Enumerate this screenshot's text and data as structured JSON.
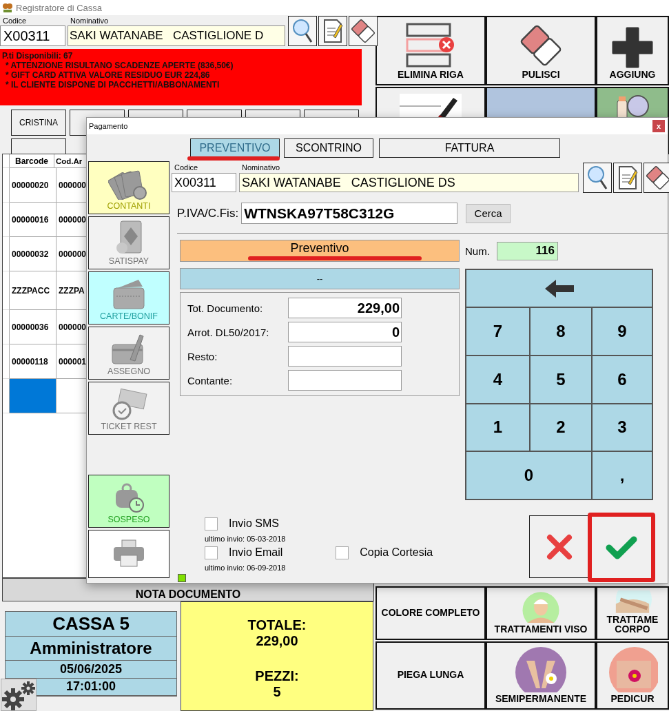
{
  "app": {
    "title": "Registratore di Cassa"
  },
  "customer": {
    "code_label": "Codice",
    "name_label": "Nominativo",
    "code": "X00311",
    "name": "SAKI WATANABE   CASTIGLIONE D"
  },
  "alert": {
    "points": "P.ti Disponibili: 67",
    "lines": [
      "* ATTENZIONE RISULTANO SCADENZE APERTE (836,50€)",
      "* GIFT CARD ATTIVA VALORE RESIDUO EUR 224,86",
      "* IL CLIENTE DISPONE DI PACCHETTI/ABBONAMENTI"
    ]
  },
  "operator_rows": [
    [
      {
        "kind": "named",
        "label": "CRISTINA"
      },
      {
        "kind": "blank"
      },
      {
        "kind": "blank"
      },
      {
        "kind": "blank"
      },
      {
        "kind": "blank"
      },
      {
        "kind": "blank"
      }
    ],
    [
      {
        "kind": "blank"
      }
    ]
  ],
  "table": {
    "columns": [
      "Barcode",
      "Cod.Ar"
    ],
    "rows": [
      {
        "cells": [
          "00000020",
          "000000"
        ],
        "selected": false
      },
      {
        "cells": [
          "00000016",
          "000000"
        ],
        "selected": false
      },
      {
        "cells": [
          "00000032",
          "000000"
        ],
        "selected": false
      },
      {
        "cells": [
          "ZZZPACC",
          "ZZZPA"
        ],
        "selected": false
      },
      {
        "cells": [
          "00000036",
          "000000"
        ],
        "selected": false
      },
      {
        "cells": [
          "00000118",
          "000001"
        ],
        "selected": false
      },
      {
        "selected": true
      }
    ]
  },
  "note_bar": "NOTA DOCUMENTO",
  "register": {
    "name": "CASSA 5",
    "user": "Amministratore",
    "date": "05/06/2025",
    "time": "17:01:00"
  },
  "totals": {
    "total_label": "TOTALE:",
    "total": "229,00",
    "pieces_label": "PEZZI:",
    "pieces": "5"
  },
  "tiles_top": [
    {
      "kind": "delete-row",
      "label": "ELIMINA RIGA",
      "color": "#f0f0f0"
    },
    {
      "kind": "eraser",
      "label": "PULISCI",
      "color": "#f0f0f0"
    },
    {
      "kind": "plus",
      "label": "AGGIUNG",
      "color": "#f0f0f0"
    },
    {
      "kind": "pen",
      "color": "#f0f0f0"
    },
    {
      "kind": "none",
      "color": "#b0c4de"
    },
    {
      "kind": "bottles",
      "color": "#8fbc8b"
    }
  ],
  "tiles_bottom": [
    {
      "kind": "none",
      "label": "COLORE COMPLETO",
      "color": "#f0f0f0"
    },
    {
      "kind": "face",
      "label": "TRATTAMENTI VISO",
      "color": "#f0f0f0"
    },
    {
      "kind": "body",
      "label": "TRATTAME CORPO",
      "color": "#f0f0f0"
    },
    {
      "kind": "none",
      "label": "PIEGA LUNGA",
      "color": "#f0f0f0"
    },
    {
      "kind": "hands",
      "label": "SEMIPERMANENTE",
      "color": "#f0f0f0"
    },
    {
      "kind": "feet",
      "label": "PEDICUR",
      "color": "#f0f0f0"
    }
  ],
  "dialog": {
    "title": "Pagamento",
    "close": "x",
    "tabs": [
      {
        "label": "PREVENTIVO",
        "selected": true
      },
      {
        "label": "SCONTRINO",
        "selected": false
      },
      {
        "label": "FATTURA",
        "selected": false
      }
    ],
    "methods": [
      {
        "kind": "cash",
        "label": "CONTANTI",
        "color": "#ffffc0"
      },
      {
        "kind": "satispay",
        "label": "SATISPAY",
        "color": "#f2f2f2"
      },
      {
        "kind": "card",
        "label": "CARTE/BONIF",
        "color": "#c0ffff"
      },
      {
        "kind": "cheque",
        "label": "ASSEGNO",
        "color": "#f2f2f2"
      },
      {
        "kind": "ticket",
        "label": "TICKET REST",
        "color": "#f2f2f2"
      },
      {
        "kind": "hold",
        "label": "SOSPESO",
        "color": "#c0ffc0"
      },
      {
        "kind": "print",
        "color": "#ffffff"
      }
    ],
    "code_label": "Codice",
    "name_label": "Nominativo",
    "code": "X00311",
    "name": "SAKI WATANABE   CASTIGLIONE DS",
    "tax_label": "P.IVA/C.Fis:",
    "tax_id": "WTNSKA97T58C312G",
    "search_button": "Cerca",
    "doc_type": "Preventivo",
    "number_label": "Num.",
    "number": "116",
    "status": "--",
    "amounts": [
      {
        "label": "Tot. Documento:",
        "value": "229,00"
      },
      {
        "label": "Arrot. DL50/2017:",
        "value": "0"
      },
      {
        "label": "Resto:"
      },
      {
        "label": "Contante:"
      }
    ],
    "keypad": [
      {
        "kind": "back"
      },
      {
        "kind": "key",
        "label": "7"
      },
      {
        "kind": "key",
        "label": "8"
      },
      {
        "kind": "key",
        "label": "9"
      },
      {
        "kind": "key",
        "label": "4"
      },
      {
        "kind": "key",
        "label": "5"
      },
      {
        "kind": "key",
        "label": "6"
      },
      {
        "kind": "key",
        "label": "1"
      },
      {
        "kind": "key",
        "label": "2"
      },
      {
        "kind": "key",
        "label": "3"
      },
      {
        "kind": "wide",
        "label": "0"
      },
      {
        "kind": "key",
        "label": ","
      }
    ],
    "notifications": [
      {
        "label": "Invio SMS",
        "checked": false,
        "last_sent": "ultimo invio: 05-03-2018"
      },
      {
        "label": "Invio Email",
        "checked": false,
        "last_sent": "ultimo invio: 06-09-2018"
      },
      {
        "label": "Copia Cortesia",
        "checked": false
      }
    ]
  }
}
